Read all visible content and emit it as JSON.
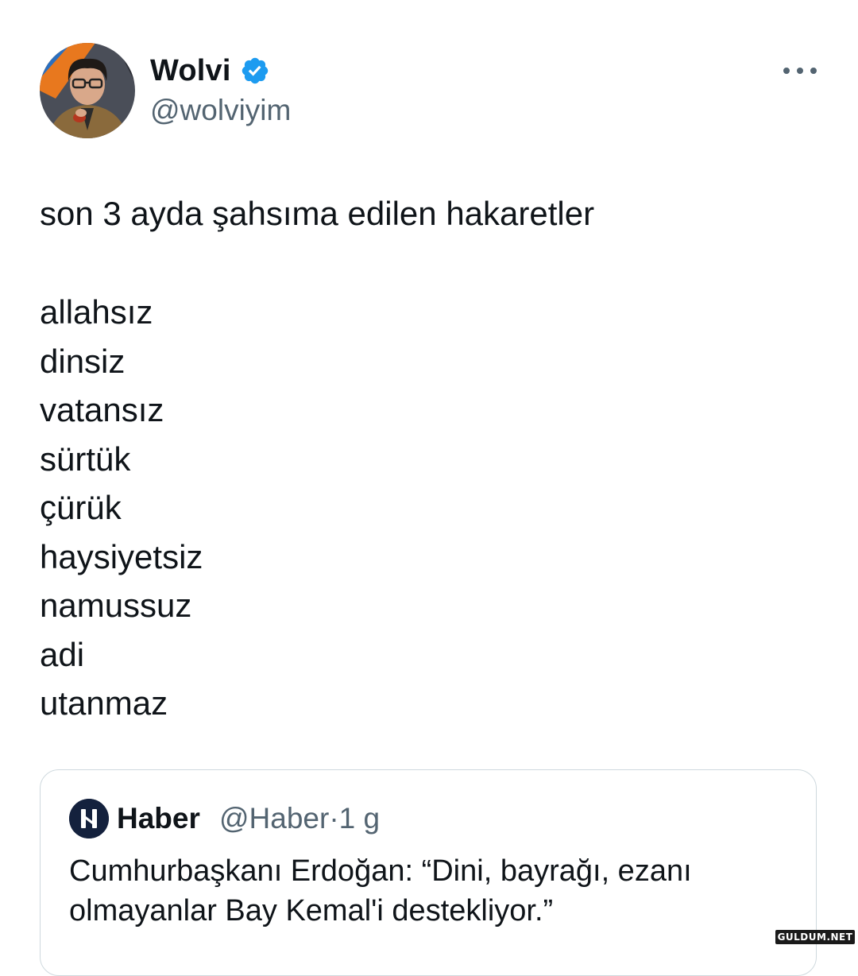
{
  "author": {
    "display_name": "Wolvi",
    "handle": "@wolviyim",
    "verified_icon": "verified-badge-icon",
    "more_icon": "more-options-icon"
  },
  "tweet": {
    "text": "son 3 ayda şahsıma edilen hakaretler",
    "insults": [
      "allahsız",
      "dinsiz",
      "vatansız",
      "sürtük",
      "çürük",
      "haysiyetsiz",
      "namussuz",
      "adi",
      "utanmaz"
    ]
  },
  "quoted": {
    "name": "Haber",
    "handle": "@Haber",
    "separator": "·",
    "time": "1 g",
    "text": "Cumhurbaşkanı Erdoğan: “Dini, bayrağı, ezanı olmayanlar Bay Kemal'i destekliyor.”",
    "logo_icon": "haber-logo-icon"
  },
  "watermark": "GULDUM.NET",
  "colors": {
    "text": "#0f1419",
    "secondary": "#536471",
    "verified": "#1d9bf0",
    "border": "#cfd9de",
    "haber_logo": "#14213d"
  }
}
